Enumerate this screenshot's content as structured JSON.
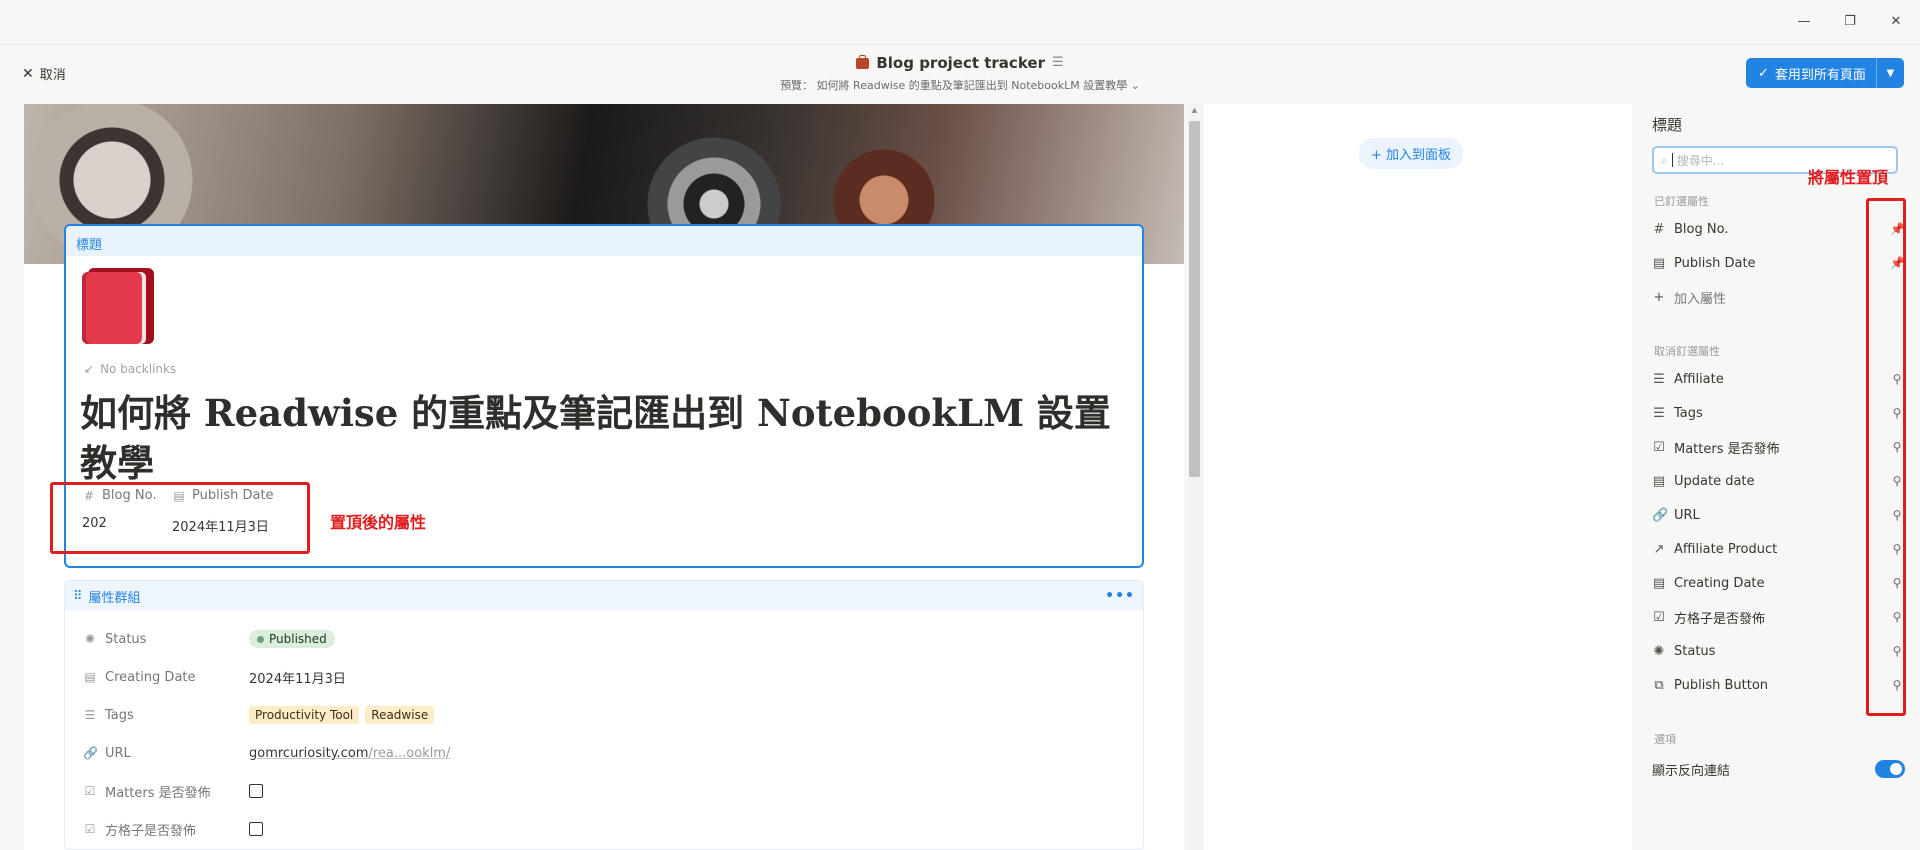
{
  "header": {
    "cancel_label": "取消",
    "db_title": "Blog project tracker",
    "preview_text": "預覽： 如何將 Readwise 的重點及筆記匯出到 NotebookLM 設置教學",
    "apply_label": "套用到所有頁面"
  },
  "page": {
    "block_label": "標題",
    "backlinks": "No backlinks",
    "title": "如何將 Readwise 的重點及筆記匯出到 NotebookLM 設置教學",
    "pinned": [
      {
        "name": "Blog No.",
        "value": "202",
        "icon": "hash-icon"
      },
      {
        "name": "Publish Date",
        "value": "2024年11月3日",
        "icon": "calendar-icon"
      }
    ],
    "annotation_pinned": "置頂後的屬性"
  },
  "group": {
    "label": "屬性群組",
    "status": {
      "name": "Status",
      "value": "Published"
    },
    "creating_date": {
      "name": "Creating Date",
      "value": "2024年11月3日"
    },
    "tags": {
      "name": "Tags",
      "values": [
        "Productivity Tool",
        "Readwise"
      ]
    },
    "url": {
      "name": "URL",
      "domain": "gomrcuriosity.com",
      "path": "/rea...ooklm/"
    },
    "matters": {
      "name": "Matters 是否發佈"
    },
    "fangge": {
      "name": "方格子是否發佈"
    }
  },
  "board": {
    "add_label": "加入到面板"
  },
  "panel": {
    "title": "標題",
    "search_placeholder": "搜尋中...",
    "annotation_pin": "將屬性置頂",
    "pinned_label": "已釘選屬性",
    "pinned": [
      {
        "name": "Blog No.",
        "icon": "hash-icon"
      },
      {
        "name": "Publish Date",
        "icon": "calendar-icon"
      }
    ],
    "add_prop": "加入屬性",
    "unpinned_label": "取消釘選屬性",
    "unpinned": [
      {
        "name": "Affiliate",
        "icon": "list-icon"
      },
      {
        "name": "Tags",
        "icon": "list-icon"
      },
      {
        "name": "Matters 是否發佈",
        "icon": "checkbox-icon"
      },
      {
        "name": "Update date",
        "icon": "calendar-icon"
      },
      {
        "name": "URL",
        "icon": "link-icon"
      },
      {
        "name": "Affiliate Product",
        "icon": "arrow-icon"
      },
      {
        "name": "Creating Date",
        "icon": "calendar-icon"
      },
      {
        "name": "方格子是否發佈",
        "icon": "checkbox-icon"
      },
      {
        "name": "Status",
        "icon": "status-icon"
      },
      {
        "name": "Publish Button",
        "icon": "button-icon"
      }
    ],
    "options_label": "選項",
    "show_backlinks_label": "顯示反向連結"
  },
  "colors": {
    "accent": "#2383e2",
    "annotation": "#e01e1e"
  }
}
